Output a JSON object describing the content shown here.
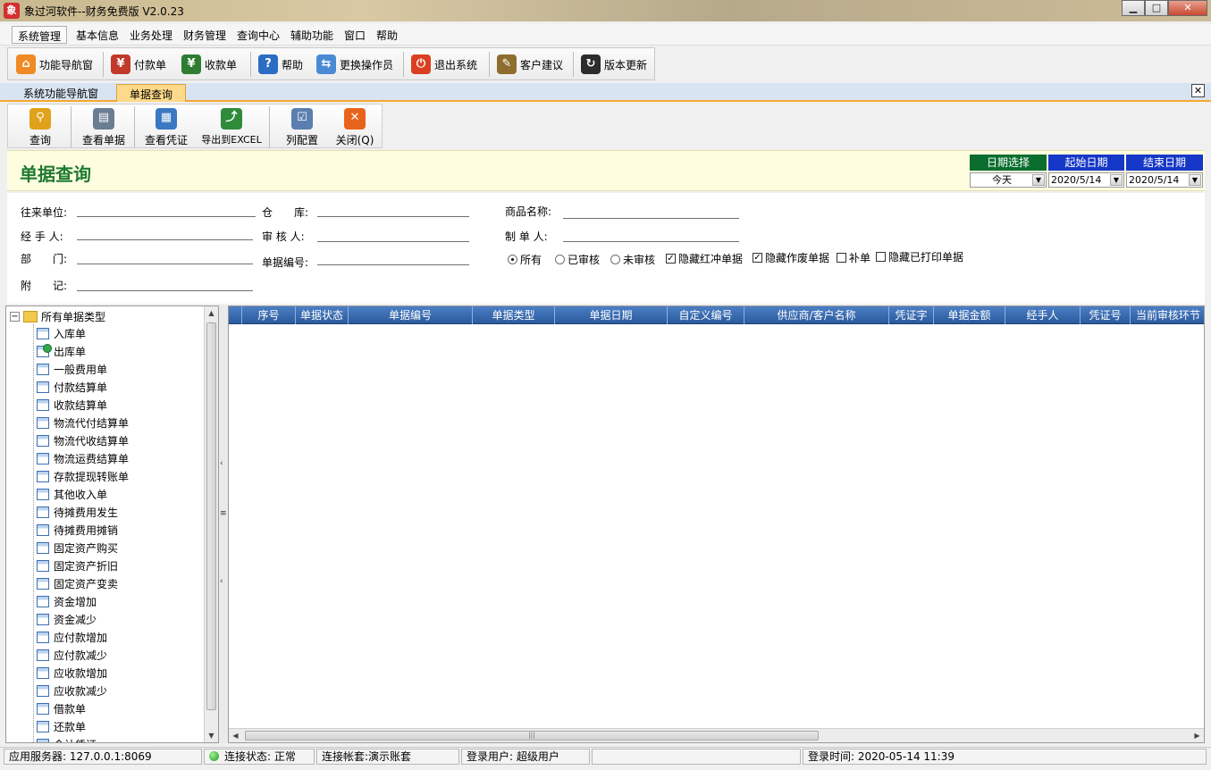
{
  "window": {
    "title": "象过河软件--财务免费版 V2.0.23",
    "icon_label": "象",
    "min_glyph": "▁",
    "max_glyph": "□",
    "close_glyph": "✕"
  },
  "menu": [
    "系统管理",
    "基本信息",
    "业务处理",
    "财务管理",
    "查询中心",
    "辅助功能",
    "窗口",
    "帮助"
  ],
  "toolbar": [
    {
      "label": "功能导航窗",
      "icon": "home-icon",
      "glyph": "⌂",
      "color": "#f08a24"
    },
    {
      "label": "付款单",
      "icon": "payment-icon",
      "glyph": "¥",
      "color": "#c0392b"
    },
    {
      "label": "收款单",
      "icon": "receipt-icon",
      "glyph": "¥",
      "color": "#2e7d32"
    },
    {
      "label": "帮助",
      "icon": "help-icon",
      "glyph": "?",
      "color": "#2b6cc4"
    },
    {
      "label": "更换操作员",
      "icon": "switch-user-icon",
      "glyph": "⇆",
      "color": "#4a8ad4"
    },
    {
      "label": "退出系统",
      "icon": "power-icon",
      "glyph": "⏻",
      "color": "#d9401f"
    },
    {
      "label": "客户建议",
      "icon": "suggestion-icon",
      "glyph": "✎",
      "color": "#8d6e2e"
    },
    {
      "label": "版本更新",
      "icon": "update-icon",
      "glyph": "↻",
      "color": "#2c2c2c"
    }
  ],
  "tabs": [
    "系统功能导航窗",
    "单据查询"
  ],
  "tab_close_glyph": "✕",
  "query_toolbar": [
    {
      "label": "查询",
      "icon": "magnifier-icon",
      "glyph": "⚲",
      "color": "#e0a21a"
    },
    {
      "label": "查看单据",
      "icon": "view-document-icon",
      "glyph": "▤",
      "color": "#6a7d92"
    },
    {
      "label": "查看凭证",
      "icon": "view-voucher-icon",
      "glyph": "▦",
      "color": "#3a78c2"
    },
    {
      "label": "导出到EXCEL",
      "icon": "excel-export-icon",
      "glyph": "⤴",
      "color": "#2e8b3a"
    },
    {
      "label": "列配置",
      "icon": "column-config-icon",
      "glyph": "☑",
      "color": "#5b7fb0"
    },
    {
      "label": "关闭(Q)",
      "icon": "close-red-icon",
      "glyph": "✕",
      "color": "#e8641c"
    }
  ],
  "page_title": "单据查询",
  "date": {
    "mode_label": "日期选择",
    "mode_value": "今天",
    "mode_color": "#0b6e2e",
    "start_label": "起始日期",
    "start_value": "2020/5/14",
    "end_label": "结束日期",
    "end_value": "2020/5/14",
    "date_color": "#1638c8",
    "arrow_glyph": "▼"
  },
  "filters": {
    "partner": "往来单位:",
    "warehouse": "仓　　库:",
    "product": "商品名称:",
    "handler": "经 手 人:",
    "auditor": "审 核 人:",
    "maker": "制 单 人:",
    "dept": "部　　门:",
    "bill_no": "单据编号:",
    "remark": "附　　记:"
  },
  "options": {
    "radio_all": "所有",
    "radio_audited": "已审核",
    "radio_unaudited": "未审核",
    "hide_red": "隐藏红冲单据",
    "hide_void": "隐藏作废单据",
    "supplement": "补单",
    "hide_printed": "隐藏已打印单据",
    "check_glyph": "✓"
  },
  "tree": {
    "root": "所有单据类型",
    "expander": "−",
    "items": [
      "入库单",
      "出库单",
      "一般费用单",
      "付款结算单",
      "收款结算单",
      "物流代付结算单",
      "物流代收结算单",
      "物流运费结算单",
      "存款提现转账单",
      "其他收入单",
      "待摊费用发生",
      "待摊费用摊销",
      "固定资产购买",
      "固定资产折旧",
      "固定资产变卖",
      "资金增加",
      "资金减少",
      "应付款增加",
      "应付款减少",
      "应收款增加",
      "应收款减少",
      "借款单",
      "还款单",
      "会计凭证"
    ]
  },
  "scroll": {
    "up": "▲",
    "down": "▼",
    "left": "◀",
    "right": "▶",
    "grip": "|||",
    "split_left": "‹",
    "split_grip": "≡"
  },
  "grid": {
    "columns": [
      "",
      "序号",
      "单据状态",
      "单据编号",
      "单据类型",
      "单据日期",
      "自定义编号",
      "供应商/客户名称",
      "凭证字",
      "单据金额",
      "经手人",
      "凭证号",
      "当前审核环节"
    ]
  },
  "status": {
    "server": "应用服务器: 127.0.0.1:8069",
    "connection": "连接状态: 正常",
    "account": "连接帐套:演示账套",
    "user": "登录用户: 超级用户",
    "login_time": "登录时间: 2020-05-14 11:39"
  }
}
